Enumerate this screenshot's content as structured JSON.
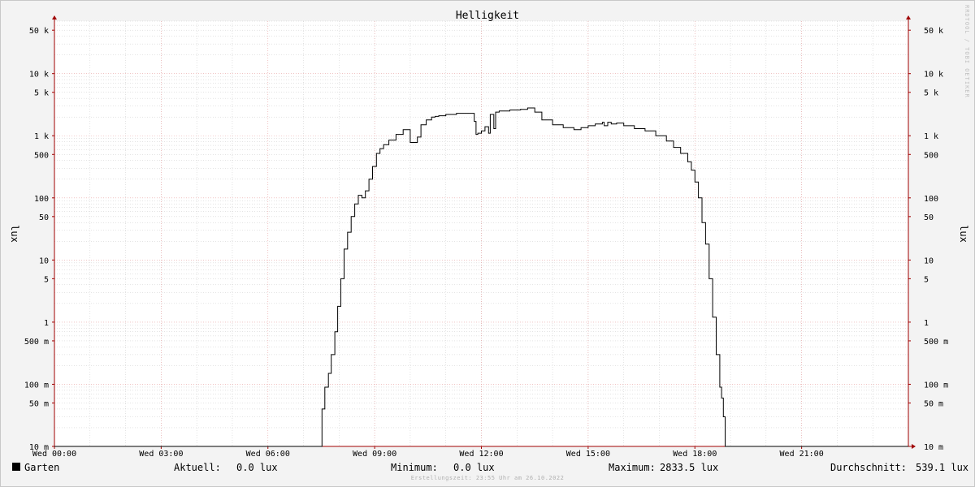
{
  "watermark": "RRDTOOL / TOBI OETIKER",
  "footer": "Erstellungszeit: 23:55 Uhr am 26.10.2022",
  "legend": {
    "series_name": "Garten",
    "current_label": "Aktuell:",
    "current_value": "0.0 lux",
    "min_label": "Minimum:",
    "min_value": "0.0 lux",
    "max_label": "Maximum:",
    "max_value": "2833.5 lux",
    "avg_label": "Durchschnitt:",
    "avg_value": "539.1 lux",
    "swatch_color": "#000000"
  },
  "colors": {
    "background": "#f3f3f3",
    "plot_background": "#ffffff",
    "major_grid": "#e8a0a0",
    "minor_grid": "#c8c8c8",
    "axis": "#a00000",
    "line": "#000000"
  },
  "chart_data": {
    "type": "line",
    "title": "Helligkeit",
    "ylabel": "lux",
    "y_scale": "log",
    "ylim": [
      0.01,
      70000
    ],
    "xlim_hours": [
      0,
      24
    ],
    "grid": true,
    "x_ticks": [
      {
        "hour": 0,
        "label": "Wed 00:00"
      },
      {
        "hour": 3,
        "label": "Wed 03:00"
      },
      {
        "hour": 6,
        "label": "Wed 06:00"
      },
      {
        "hour": 9,
        "label": "Wed 09:00"
      },
      {
        "hour": 12,
        "label": "Wed 12:00"
      },
      {
        "hour": 15,
        "label": "Wed 15:00"
      },
      {
        "hour": 18,
        "label": "Wed 18:00"
      },
      {
        "hour": 21,
        "label": "Wed 21:00"
      }
    ],
    "y_ticks": [
      {
        "value": 50000,
        "label": "50 k"
      },
      {
        "value": 10000,
        "label": "10 k"
      },
      {
        "value": 5000,
        "label": "5 k"
      },
      {
        "value": 1000,
        "label": "1 k"
      },
      {
        "value": 500,
        "label": "500"
      },
      {
        "value": 100,
        "label": "100"
      },
      {
        "value": 50,
        "label": "50"
      },
      {
        "value": 10,
        "label": "10"
      },
      {
        "value": 5,
        "label": "5"
      },
      {
        "value": 1,
        "label": "1"
      },
      {
        "value": 0.5,
        "label": "500 m"
      },
      {
        "value": 0.1,
        "label": "100 m"
      },
      {
        "value": 0.05,
        "label": "50 m"
      },
      {
        "value": 0.01,
        "label": "10 m"
      }
    ],
    "series": [
      {
        "name": "Garten",
        "x": [
          0,
          7.5,
          7.52,
          7.6,
          7.7,
          7.78,
          7.88,
          7.96,
          8.05,
          8.14,
          8.24,
          8.34,
          8.44,
          8.54,
          8.64,
          8.74,
          8.84,
          8.94,
          9.05,
          9.15,
          9.25,
          9.4,
          9.6,
          9.8,
          10.0,
          10.2,
          10.3,
          10.45,
          10.6,
          10.7,
          10.8,
          11.0,
          11.3,
          11.6,
          11.8,
          11.85,
          11.9,
          12.0,
          12.1,
          12.2,
          12.25,
          12.35,
          12.4,
          12.5,
          12.8,
          13.1,
          13.3,
          13.5,
          13.7,
          14.0,
          14.3,
          14.6,
          14.8,
          15.0,
          15.2,
          15.4,
          15.45,
          15.55,
          15.65,
          15.8,
          16.0,
          16.3,
          16.6,
          16.9,
          17.2,
          17.4,
          17.6,
          17.8,
          17.9,
          18.0,
          18.1,
          18.2,
          18.3,
          18.4,
          18.5,
          18.6,
          18.7,
          18.75,
          18.8,
          18.85,
          18.9,
          18.95,
          19.05,
          19.15,
          19.2,
          19.3,
          24
        ],
        "y": [
          0.01,
          0.01,
          0.04,
          0.09,
          0.15,
          0.3,
          0.7,
          1.8,
          5,
          15,
          28,
          50,
          80,
          110,
          100,
          130,
          200,
          320,
          520,
          620,
          720,
          850,
          1050,
          1250,
          780,
          950,
          1500,
          1800,
          2000,
          2050,
          2100,
          2200,
          2300,
          2300,
          1700,
          1050,
          1100,
          1200,
          1400,
          1100,
          2200,
          1300,
          2400,
          2500,
          2600,
          2650,
          2800,
          2400,
          1800,
          1500,
          1350,
          1250,
          1350,
          1450,
          1550,
          1650,
          1450,
          1650,
          1550,
          1600,
          1450,
          1300,
          1200,
          1000,
          820,
          650,
          520,
          380,
          280,
          180,
          100,
          40,
          18,
          5,
          1.2,
          0.3,
          0.09,
          0.06,
          0.03,
          0.01,
          0.01,
          0.01,
          0.01,
          0.01,
          0.01,
          0.01,
          0.01
        ]
      }
    ]
  }
}
